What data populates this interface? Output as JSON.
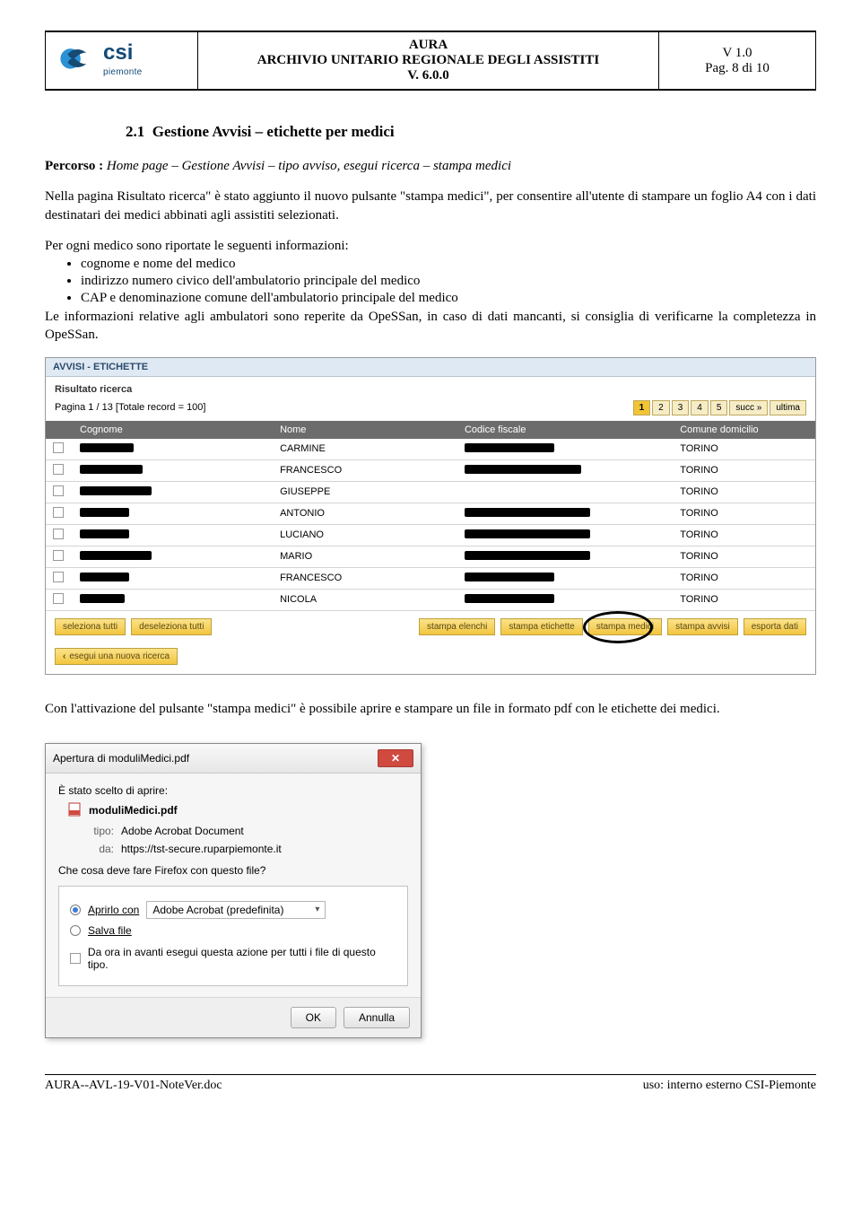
{
  "header": {
    "logo_text": "csi",
    "logo_sub": "piemonte",
    "title_line1": "AURA",
    "title_line2": "ARCHIVIO UNITARIO REGIONALE DEGLI ASSISTITI",
    "title_line3": "V. 6.0.0",
    "version": "V 1.0",
    "page_info": "Pag. 8 di 10"
  },
  "section": {
    "num": "2.1",
    "title": "Gestione Avvisi – etichette per medici",
    "percorso_label": "Percorso :",
    "percorso_path": "Home page – Gestione Avvisi – tipo avviso, esegui ricerca – stampa medici",
    "para1": "Nella pagina Risultato ricerca\" è stato aggiunto il nuovo pulsante \"stampa medici\", per consentire all'utente di stampare un foglio A4 con i dati destinatari dei medici abbinati agli assistiti selezionati.",
    "para2": "Per ogni medico sono riportate le seguenti informazioni:",
    "bullets": [
      "cognome e nome del medico",
      "indirizzo numero civico dell'ambulatorio principale del medico",
      "CAP e denominazione comune dell'ambulatorio principale del medico"
    ],
    "para3": "Le informazioni relative agli ambulatori sono reperite da OpeSSan, in caso di dati mancanti, si consiglia di verificarne la completezza in OpeSSan.",
    "after_shot": "Con l'attivazione del pulsante \"stampa medici\" è possibile aprire e stampare un file in formato pdf con le etichette dei medici."
  },
  "shot1": {
    "head": "AVVISI - ETICHETTE",
    "sub": "Risultato ricerca",
    "pageinfo": "Pagina 1 / 13 [Totale record = 100]",
    "pager": {
      "pages": [
        "1",
        "2",
        "3",
        "4",
        "5"
      ],
      "next": "succ »",
      "last": "ultima"
    },
    "cols": {
      "c1": "Cognome",
      "c2": "Nome",
      "c3": "Codice fiscale",
      "c4": "Comune domicilio"
    },
    "rows": [
      {
        "nome": "CARMINE",
        "comune": "TORINO",
        "w1": 60,
        "w3": 100
      },
      {
        "nome": "FRANCESCO",
        "comune": "TORINO",
        "w1": 70,
        "w3": 130
      },
      {
        "nome": "GIUSEPPE",
        "comune": "TORINO",
        "w1": 80,
        "w3": 0
      },
      {
        "nome": "ANTONIO",
        "comune": "TORINO",
        "w1": 55,
        "w3": 140
      },
      {
        "nome": "LUCIANO",
        "comune": "TORINO",
        "w1": 55,
        "w3": 140
      },
      {
        "nome": "MARIO",
        "comune": "TORINO",
        "w1": 80,
        "w3": 140
      },
      {
        "nome": "FRANCESCO",
        "comune": "TORINO",
        "w1": 55,
        "w3": 100
      },
      {
        "nome": "NICOLA",
        "comune": "TORINO",
        "w1": 50,
        "w3": 100
      }
    ],
    "btns_left": [
      "seleziona tutti",
      "deseleziona tutti"
    ],
    "btns_right": [
      "stampa elenchi",
      "stampa etichette",
      "stampa medici",
      "stampa avvisi",
      "esporta dati"
    ],
    "back": "esegui una nuova ricerca"
  },
  "dlg": {
    "title": "Apertura di moduliMedici.pdf",
    "heading": "È stato scelto di aprire:",
    "filename": "moduliMedici.pdf",
    "tipo_label": "tipo:",
    "tipo_val": "Adobe Acrobat Document",
    "da_label": "da:",
    "da_val": "https://tst-secure.ruparpiemonte.it",
    "question": "Che cosa deve fare Firefox con questo file?",
    "open_label": "Aprirlo con",
    "open_app": "Adobe Acrobat (predefinita)",
    "save_label": "Salva file",
    "remember": "Da ora in avanti esegui questa azione per tutti i file di questo tipo.",
    "ok": "OK",
    "cancel": "Annulla"
  },
  "footer": {
    "left": "AURA--AVL-19-V01-NoteVer.doc",
    "right": "uso: interno esterno CSI-Piemonte"
  }
}
